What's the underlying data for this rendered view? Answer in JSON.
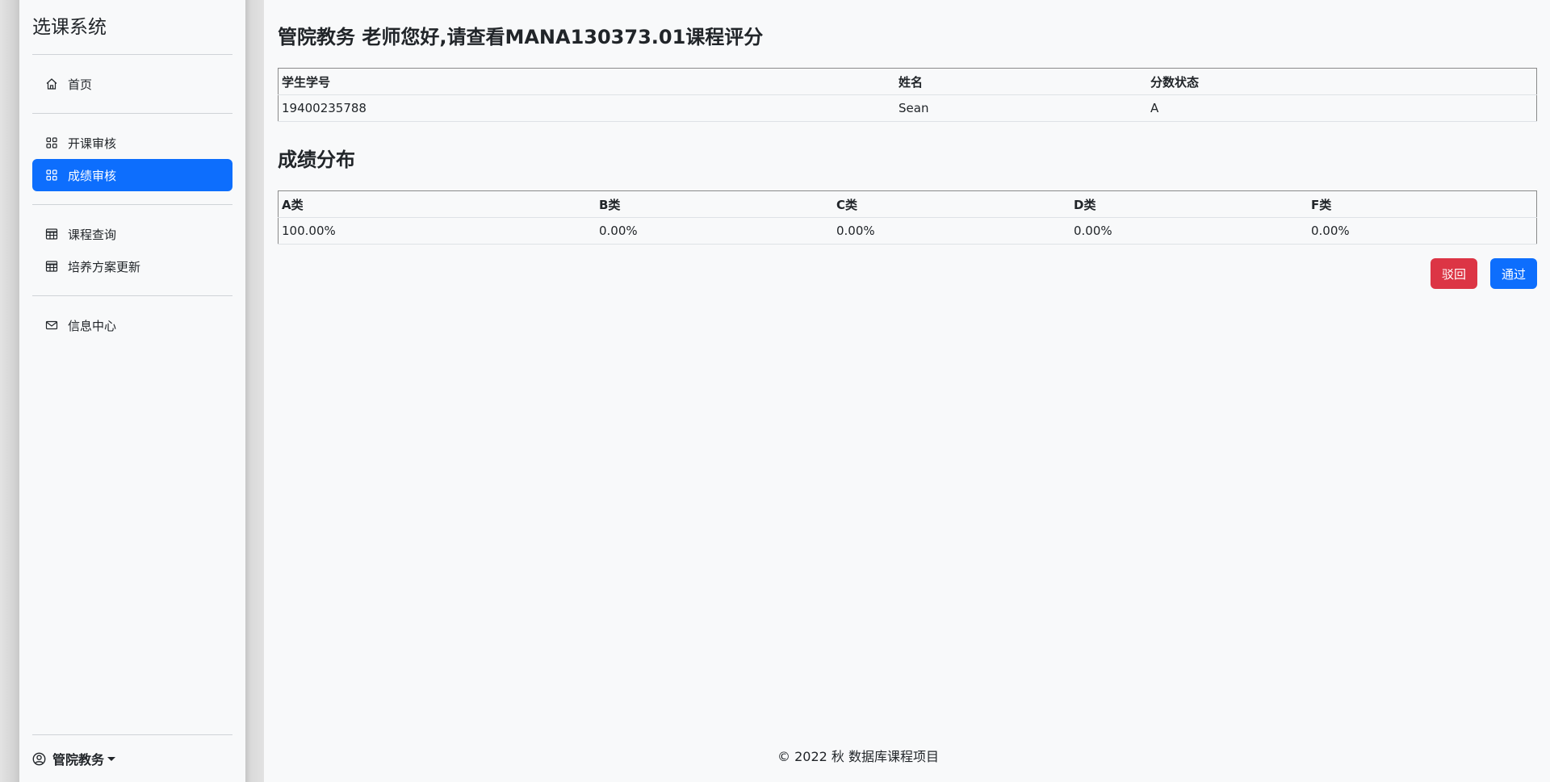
{
  "sidebar": {
    "brand": "选课系统",
    "group1": [
      {
        "label": "首页",
        "icon": "house-icon"
      }
    ],
    "group2": [
      {
        "label": "开课审核",
        "icon": "grid-icon"
      },
      {
        "label": "成绩审核",
        "icon": "grid-icon",
        "active": true
      }
    ],
    "group3": [
      {
        "label": "课程查询",
        "icon": "table-icon"
      },
      {
        "label": "培养方案更新",
        "icon": "table-icon"
      }
    ],
    "group4": [
      {
        "label": "信息中心",
        "icon": "envelope-icon"
      }
    ],
    "user": {
      "label": "管院教务",
      "icon": "person-circle-icon"
    }
  },
  "main": {
    "title": "管院教务 老师您好,请查看MANA130373.01课程评分",
    "students_table": {
      "headers": [
        "学生学号",
        "姓名",
        "分数状态"
      ],
      "rows": [
        [
          "19400235788",
          "Sean",
          "A"
        ]
      ]
    },
    "distribution_title": "成绩分布",
    "distribution_table": {
      "headers": [
        "A类",
        "B类",
        "C类",
        "D类",
        "F类"
      ],
      "rows": [
        [
          "100.00%",
          "0.00%",
          "0.00%",
          "0.00%",
          "0.00%"
        ]
      ]
    },
    "buttons": {
      "reject": "驳回",
      "approve": "通过"
    },
    "footer": "© 2022 秋 数据库课程项目"
  },
  "colors": {
    "primary": "#0d6efd",
    "danger": "#dc3545",
    "background": "#f8f9fa"
  }
}
